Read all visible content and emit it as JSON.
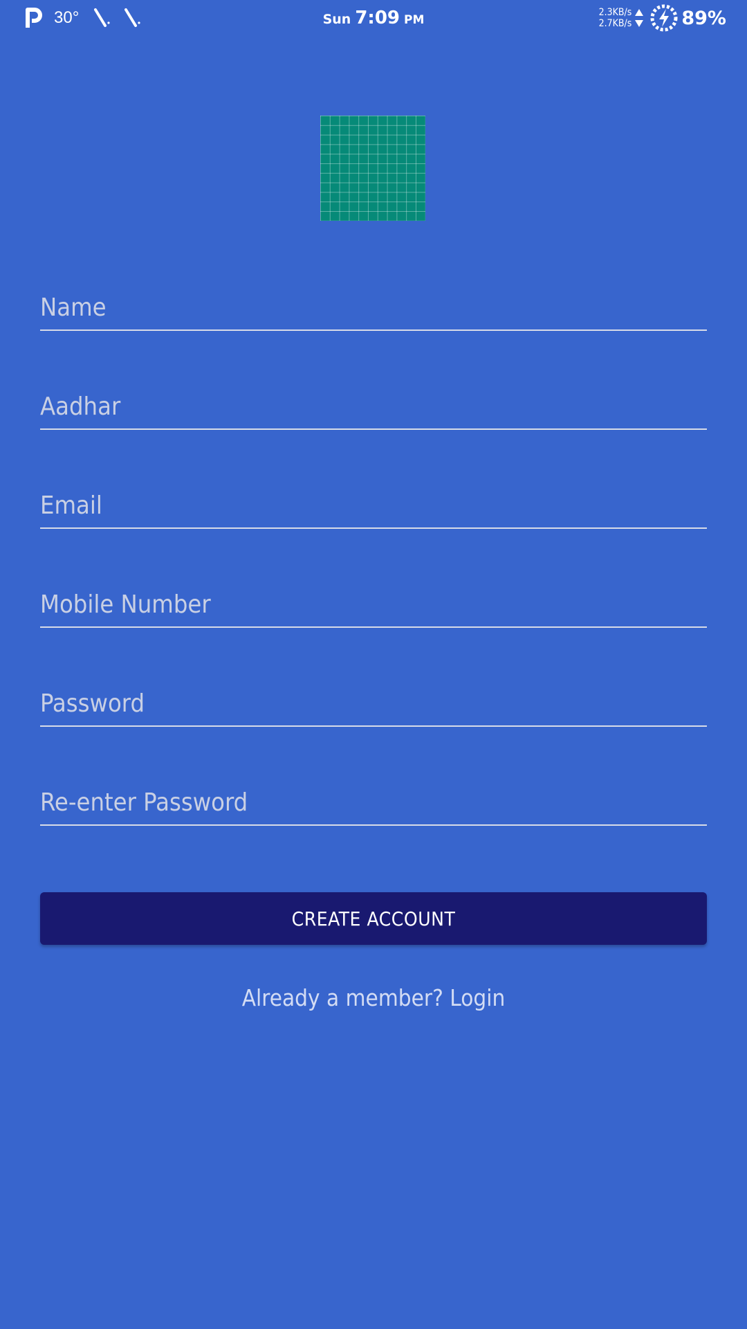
{
  "status_bar": {
    "app_icon": "p-icon",
    "temperature": "30°",
    "nav_icons": [
      "navigation-icon",
      "navigation-icon"
    ],
    "day": "Sun",
    "time": "7:09",
    "ampm": "PM",
    "net_up": "2.3KB/s",
    "net_down": "2.7KB/s",
    "battery_icon": "battery-charging-icon",
    "battery": "89%"
  },
  "logo": {
    "icon": "grid-logo-icon",
    "color": "#068a78"
  },
  "form": {
    "fields": [
      {
        "placeholder": "Name",
        "type": "text"
      },
      {
        "placeholder": "Aadhar",
        "type": "text"
      },
      {
        "placeholder": "Email",
        "type": "email"
      },
      {
        "placeholder": "Mobile Number",
        "type": "tel"
      },
      {
        "placeholder": "Password",
        "type": "password"
      },
      {
        "placeholder": "Re-enter Password",
        "type": "password"
      }
    ],
    "submit_label": "CREATE ACCOUNT",
    "login_link": "Already a member? Login"
  },
  "colors": {
    "background": "#3865cd",
    "button": "#191970",
    "logo": "#068a78"
  }
}
